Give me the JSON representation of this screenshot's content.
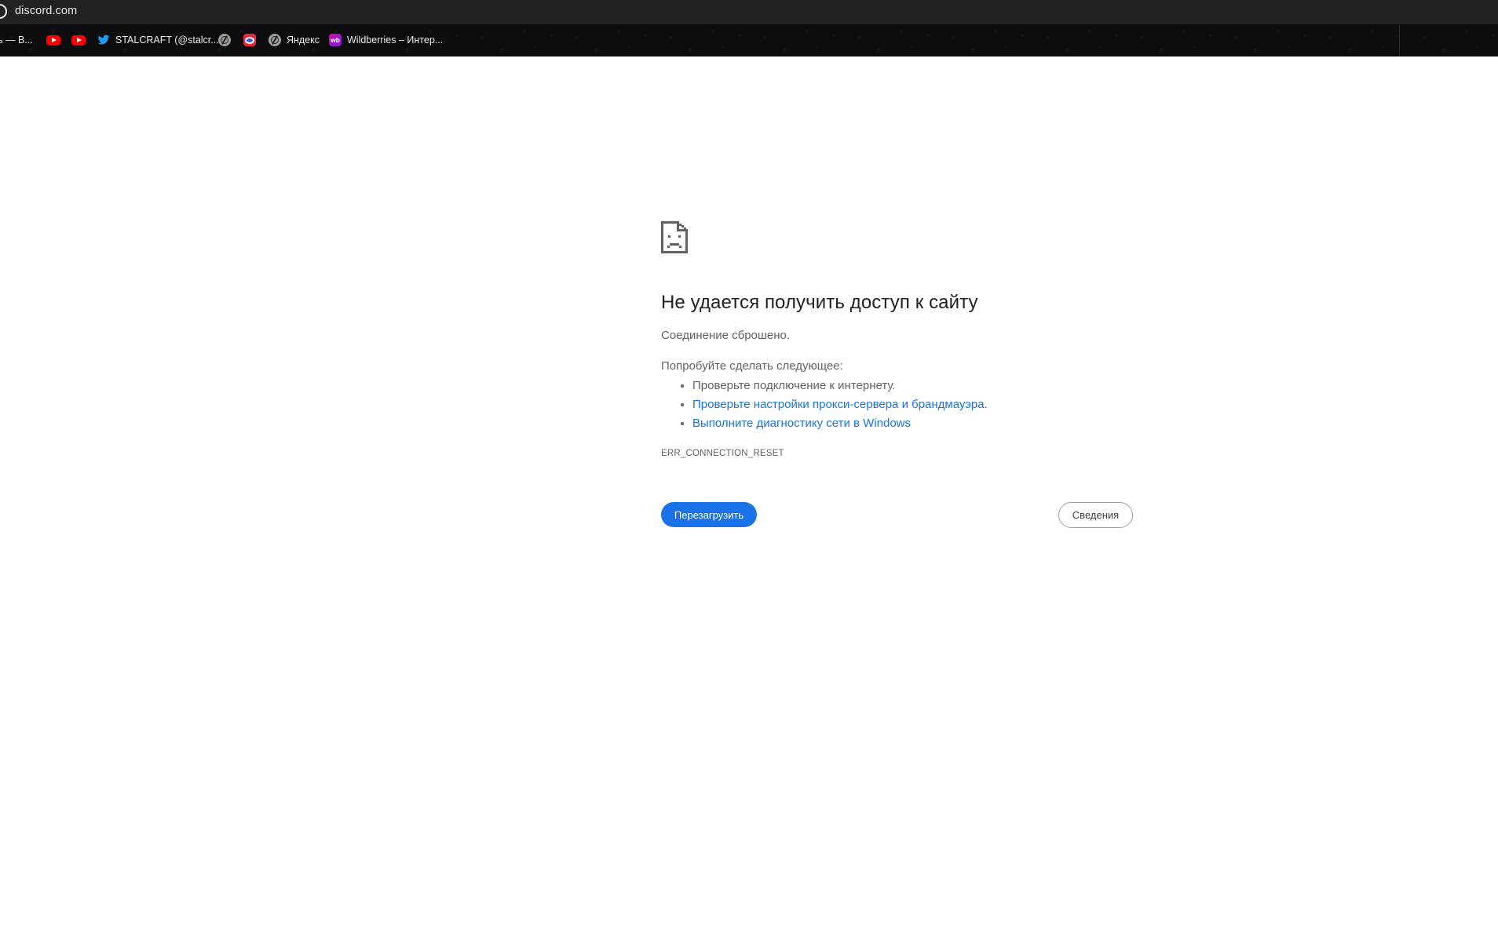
{
  "browser": {
    "url": "discord.com",
    "bookmarks": [
      {
        "label": "ь — В...",
        "icon": "none"
      },
      {
        "label": "",
        "icon": "youtube-icon"
      },
      {
        "label": "",
        "icon": "youtube-icon"
      },
      {
        "label": "STALCRAFT (@stalcr...",
        "icon": "twitter-icon"
      },
      {
        "label": "",
        "icon": "globe-icon"
      },
      {
        "label": "",
        "icon": "ring-logo-icon"
      },
      {
        "label": "Яндекс",
        "icon": "globe-icon"
      },
      {
        "label": "Wildberries – Интер...",
        "icon": "wildberries-icon"
      }
    ],
    "wb_icon_text": "wb"
  },
  "error_page": {
    "heading": "Не удается получить доступ к сайту",
    "summary": "Соединение сброшено.",
    "suggestions_title": "Попробуйте сделать следующее:",
    "suggestions": [
      {
        "text": "Проверьте подключение к интернету.",
        "is_link": false
      },
      {
        "text": "Проверьте настройки прокси-сервера и брандмауэра",
        "is_link": true,
        "suffix": "."
      },
      {
        "text": "Выполните диагностику сети в Windows",
        "is_link": true
      }
    ],
    "error_code": "ERR_CONNECTION_RESET",
    "reload_button": "Перезагрузить",
    "details_button": "Сведения"
  },
  "colors": {
    "link": "#1a73e8",
    "primary_button": "#1a73e8",
    "text_secondary": "#5f6368",
    "heading": "#202124",
    "chrome_bg": "#202124"
  }
}
